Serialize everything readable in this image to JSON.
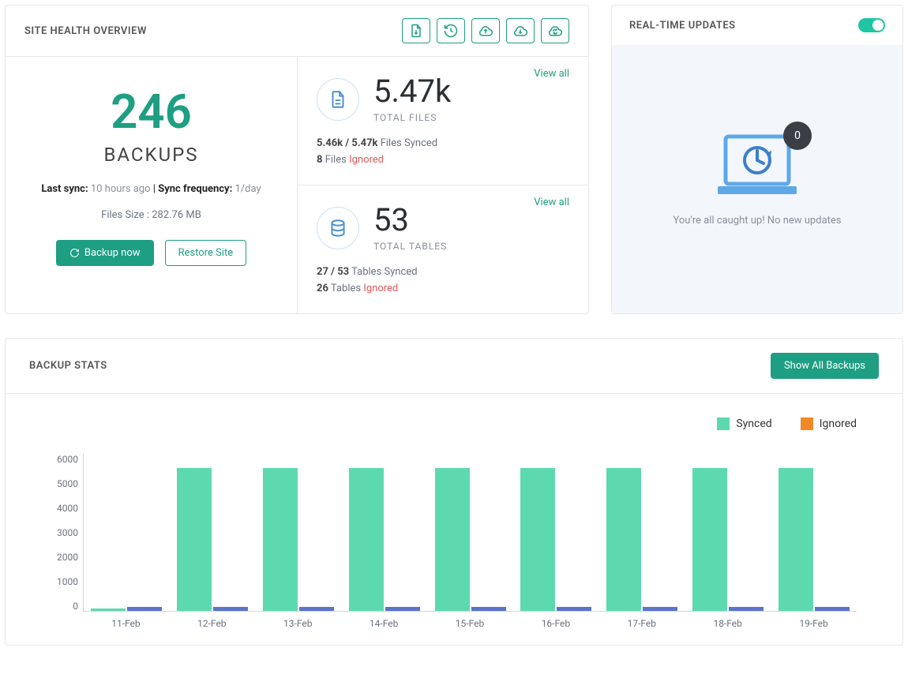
{
  "health": {
    "title": "SITE HEALTH OVERVIEW",
    "backups_count": "246",
    "backups_label": "BACKUPS",
    "last_sync_label": "Last sync:",
    "last_sync_value": "10 hours ago",
    "sep": "|",
    "sync_freq_label": "Sync frequency:",
    "sync_freq_value": "1/day",
    "files_size": "Files Size : 282.76 MB",
    "backup_now": "Backup now",
    "restore_site": "Restore Site",
    "files_block": {
      "view_all": "View all",
      "value": "5.47k",
      "label": "TOTAL FILES",
      "synced_bold": "5.46k / 5.47k",
      "synced_text": "Files Synced",
      "ignored_bold": "8",
      "ignored_text": "Files",
      "ignored_word": "Ignored"
    },
    "tables_block": {
      "view_all": "View all",
      "value": "53",
      "label": "TOTAL TABLES",
      "synced_bold": "27 / 53",
      "synced_text": "Tables Synced",
      "ignored_bold": "26",
      "ignored_text": "Tables",
      "ignored_word": "Ignored"
    }
  },
  "realtime": {
    "title": "REAL-TIME UPDATES",
    "badge": "0",
    "caught_up": "You're all caught up! No new updates"
  },
  "stats": {
    "title": "BACKUP STATS",
    "show_all": "Show All Backups",
    "legend_synced": "Synced",
    "legend_ignored": "Ignored"
  },
  "chart_data": {
    "type": "bar",
    "categories": [
      "11-Feb",
      "12-Feb",
      "13-Feb",
      "14-Feb",
      "15-Feb",
      "16-Feb",
      "17-Feb",
      "18-Feb",
      "19-Feb"
    ],
    "series": [
      {
        "name": "Synced",
        "values": [
          100,
          5470,
          5470,
          5470,
          5470,
          5470,
          5470,
          5470,
          5470
        ]
      },
      {
        "name": "Ignored",
        "values": [
          150,
          150,
          150,
          150,
          150,
          150,
          150,
          150,
          150
        ]
      }
    ],
    "ylim": [
      0,
      6000
    ],
    "yticks": [
      6000,
      5000,
      4000,
      3000,
      2000,
      1000,
      0
    ]
  }
}
